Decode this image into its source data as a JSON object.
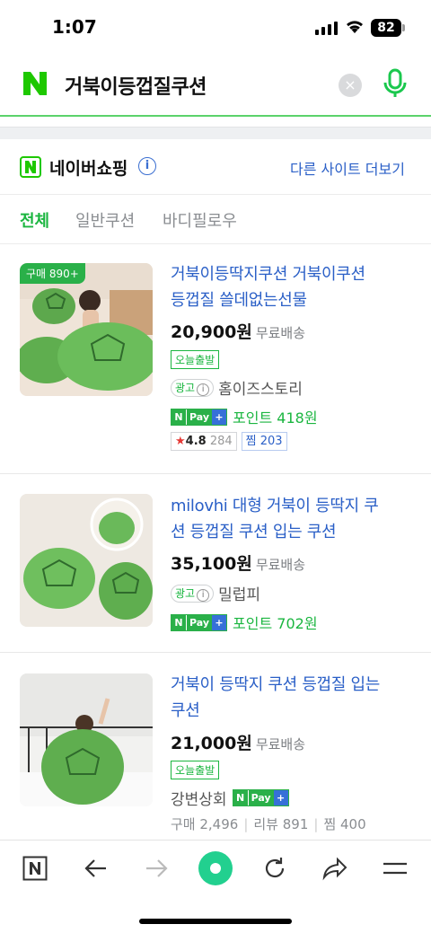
{
  "status": {
    "time": "1:07",
    "battery": "82"
  },
  "search": {
    "query": "거북이등껍질쿠션",
    "clear_icon": "×"
  },
  "shopping": {
    "name": "네이버쇼핑",
    "more_link": "다른 사이트 더보기",
    "info_icon": "i"
  },
  "tabs": [
    {
      "label": "전체",
      "active": true
    },
    {
      "label": "일반쿠션",
      "active": false
    },
    {
      "label": "바디필로우",
      "active": false
    }
  ],
  "products": [
    {
      "badge": "구매 890+",
      "title_line1": "거북이등딱지쿠션 거북이쿠션",
      "title_line2": "등껍질 쓸데없는선물",
      "price": "20,900원",
      "shipping": "무료배송",
      "tag": "오늘출발",
      "ad_label": "광고",
      "seller": "홈이즈스토리",
      "point": "포인트 418원",
      "rating": "4.8",
      "reviews": "284",
      "zzim": "찜 203"
    },
    {
      "title_line1": "milovhi 대형 거북이 등딱지 쿠",
      "title_line2": "션 등껍질 쿠션 입는 쿠션",
      "price": "35,100원",
      "shipping": "무료배송",
      "ad_label": "광고",
      "seller": "밀럽피",
      "point": "포인트 702원"
    },
    {
      "title_line1": "거북이 등딱지 쿠션 등껍질 입는",
      "title_line2": "쿠션",
      "price": "21,000원",
      "shipping": "무료배송",
      "tag": "오늘출발",
      "seller": "강변상회",
      "stat_buy": "구매 2,496",
      "stat_review": "리뷰 891",
      "stat_zzim": "찜 400"
    }
  ],
  "pay_label": {
    "n": "N",
    "pay": "Pay",
    "plus": "+"
  },
  "colors": {
    "naver_green": "#1bb640",
    "link_blue": "#2a5fc7",
    "pay_blue": "#3670d8"
  }
}
